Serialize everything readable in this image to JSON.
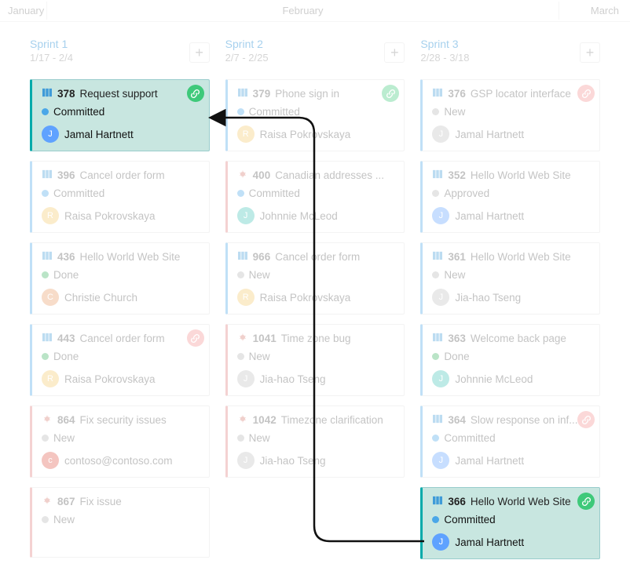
{
  "months": {
    "jan": "January",
    "feb": "February",
    "mar": "March"
  },
  "columns": [
    {
      "title": "Sprint 1",
      "dates": "1/17 - 2/4",
      "cards": [
        {
          "id": "378",
          "title": "Request support",
          "state": "Committed",
          "stateColor": "sc-blue",
          "type": "pbi",
          "person": "Jamal Hartnett",
          "avatar": "av-blue",
          "highlight": true,
          "link": "green",
          "bl": "bl-teal"
        },
        {
          "id": "396",
          "title": "Cancel order form",
          "state": "Committed",
          "stateColor": "sc-blue",
          "type": "pbi",
          "person": "Raisa Pokrovskaya",
          "avatar": "av-yellow",
          "bl": "bl-blue"
        },
        {
          "id": "436",
          "title": "Hello World Web Site",
          "state": "Done",
          "stateColor": "sc-green",
          "type": "pbi",
          "person": "Christie Church",
          "avatar": "av-orange",
          "bl": "bl-blue"
        },
        {
          "id": "443",
          "title": "Cancel order form",
          "state": "Done",
          "stateColor": "sc-green",
          "type": "pbi",
          "person": "Raisa Pokrovskaya",
          "avatar": "av-yellow",
          "link": "red",
          "bl": "bl-blue"
        },
        {
          "id": "864",
          "title": "Fix security issues",
          "state": "New",
          "stateColor": "sc-gray",
          "type": "bug",
          "person": "contoso@contoso.com",
          "avatar": "av-red",
          "bl": "bl-red"
        },
        {
          "id": "867",
          "title": "Fix issue",
          "state": "New",
          "stateColor": "sc-gray",
          "type": "bug",
          "person": "",
          "avatar": "",
          "bl": "bl-red"
        }
      ]
    },
    {
      "title": "Sprint 2",
      "dates": "2/7 - 2/25",
      "cards": [
        {
          "id": "379",
          "title": "Phone sign in",
          "state": "Committed",
          "stateColor": "sc-blue",
          "type": "pbi",
          "person": "Raisa Pokrovskaya",
          "avatar": "av-yellow",
          "link": "green",
          "bl": "bl-blue"
        },
        {
          "id": "400",
          "title": "Canadian addresses ...",
          "state": "Committed",
          "stateColor": "sc-blue",
          "type": "bug",
          "person": "Johnnie McLeod",
          "avatar": "av-teal",
          "bl": "bl-red"
        },
        {
          "id": "966",
          "title": "Cancel order form",
          "state": "New",
          "stateColor": "sc-gray",
          "type": "pbi",
          "person": "Raisa Pokrovskaya",
          "avatar": "av-yellow",
          "bl": "bl-blue"
        },
        {
          "id": "1041",
          "title": "Time zone bug",
          "state": "New",
          "stateColor": "sc-gray",
          "type": "bug",
          "person": "Jia-hao Tseng",
          "avatar": "av-gray",
          "bl": "bl-red"
        },
        {
          "id": "1042",
          "title": "Timezone clarification",
          "state": "New",
          "stateColor": "sc-gray",
          "type": "bug",
          "person": "Jia-hao Tseng",
          "avatar": "av-gray",
          "bl": "bl-red"
        }
      ]
    },
    {
      "title": "Sprint 3",
      "dates": "2/28 - 3/18",
      "cards": [
        {
          "id": "376",
          "title": "GSP locator interface",
          "state": "New",
          "stateColor": "sc-gray",
          "type": "pbi",
          "person": "Jamal Hartnett",
          "avatar": "av-gray",
          "link": "red",
          "bl": "bl-blue"
        },
        {
          "id": "352",
          "title": "Hello World Web Site",
          "state": "Approved",
          "stateColor": "sc-gray",
          "type": "pbi",
          "person": "Jamal Hartnett",
          "avatar": "av-blue",
          "bl": "bl-blue"
        },
        {
          "id": "361",
          "title": "Hello World Web Site",
          "state": "New",
          "stateColor": "sc-gray",
          "type": "pbi",
          "person": "Jia-hao Tseng",
          "avatar": "av-gray",
          "bl": "bl-blue"
        },
        {
          "id": "363",
          "title": "Welcome back page",
          "state": "Done",
          "stateColor": "sc-green",
          "type": "pbi",
          "person": "Johnnie McLeod",
          "avatar": "av-teal",
          "bl": "bl-blue"
        },
        {
          "id": "364",
          "title": "Slow response on inf...",
          "state": "Committed",
          "stateColor": "sc-blue",
          "type": "pbi",
          "person": "Jamal Hartnett",
          "avatar": "av-blue",
          "link": "red",
          "bl": "bl-blue"
        },
        {
          "id": "366",
          "title": "Hello World Web Site",
          "state": "Committed",
          "stateColor": "sc-blue",
          "type": "pbi",
          "person": "Jamal Hartnett",
          "avatar": "av-blue",
          "highlight": true,
          "link": "green",
          "bl": "bl-teal"
        }
      ]
    }
  ]
}
